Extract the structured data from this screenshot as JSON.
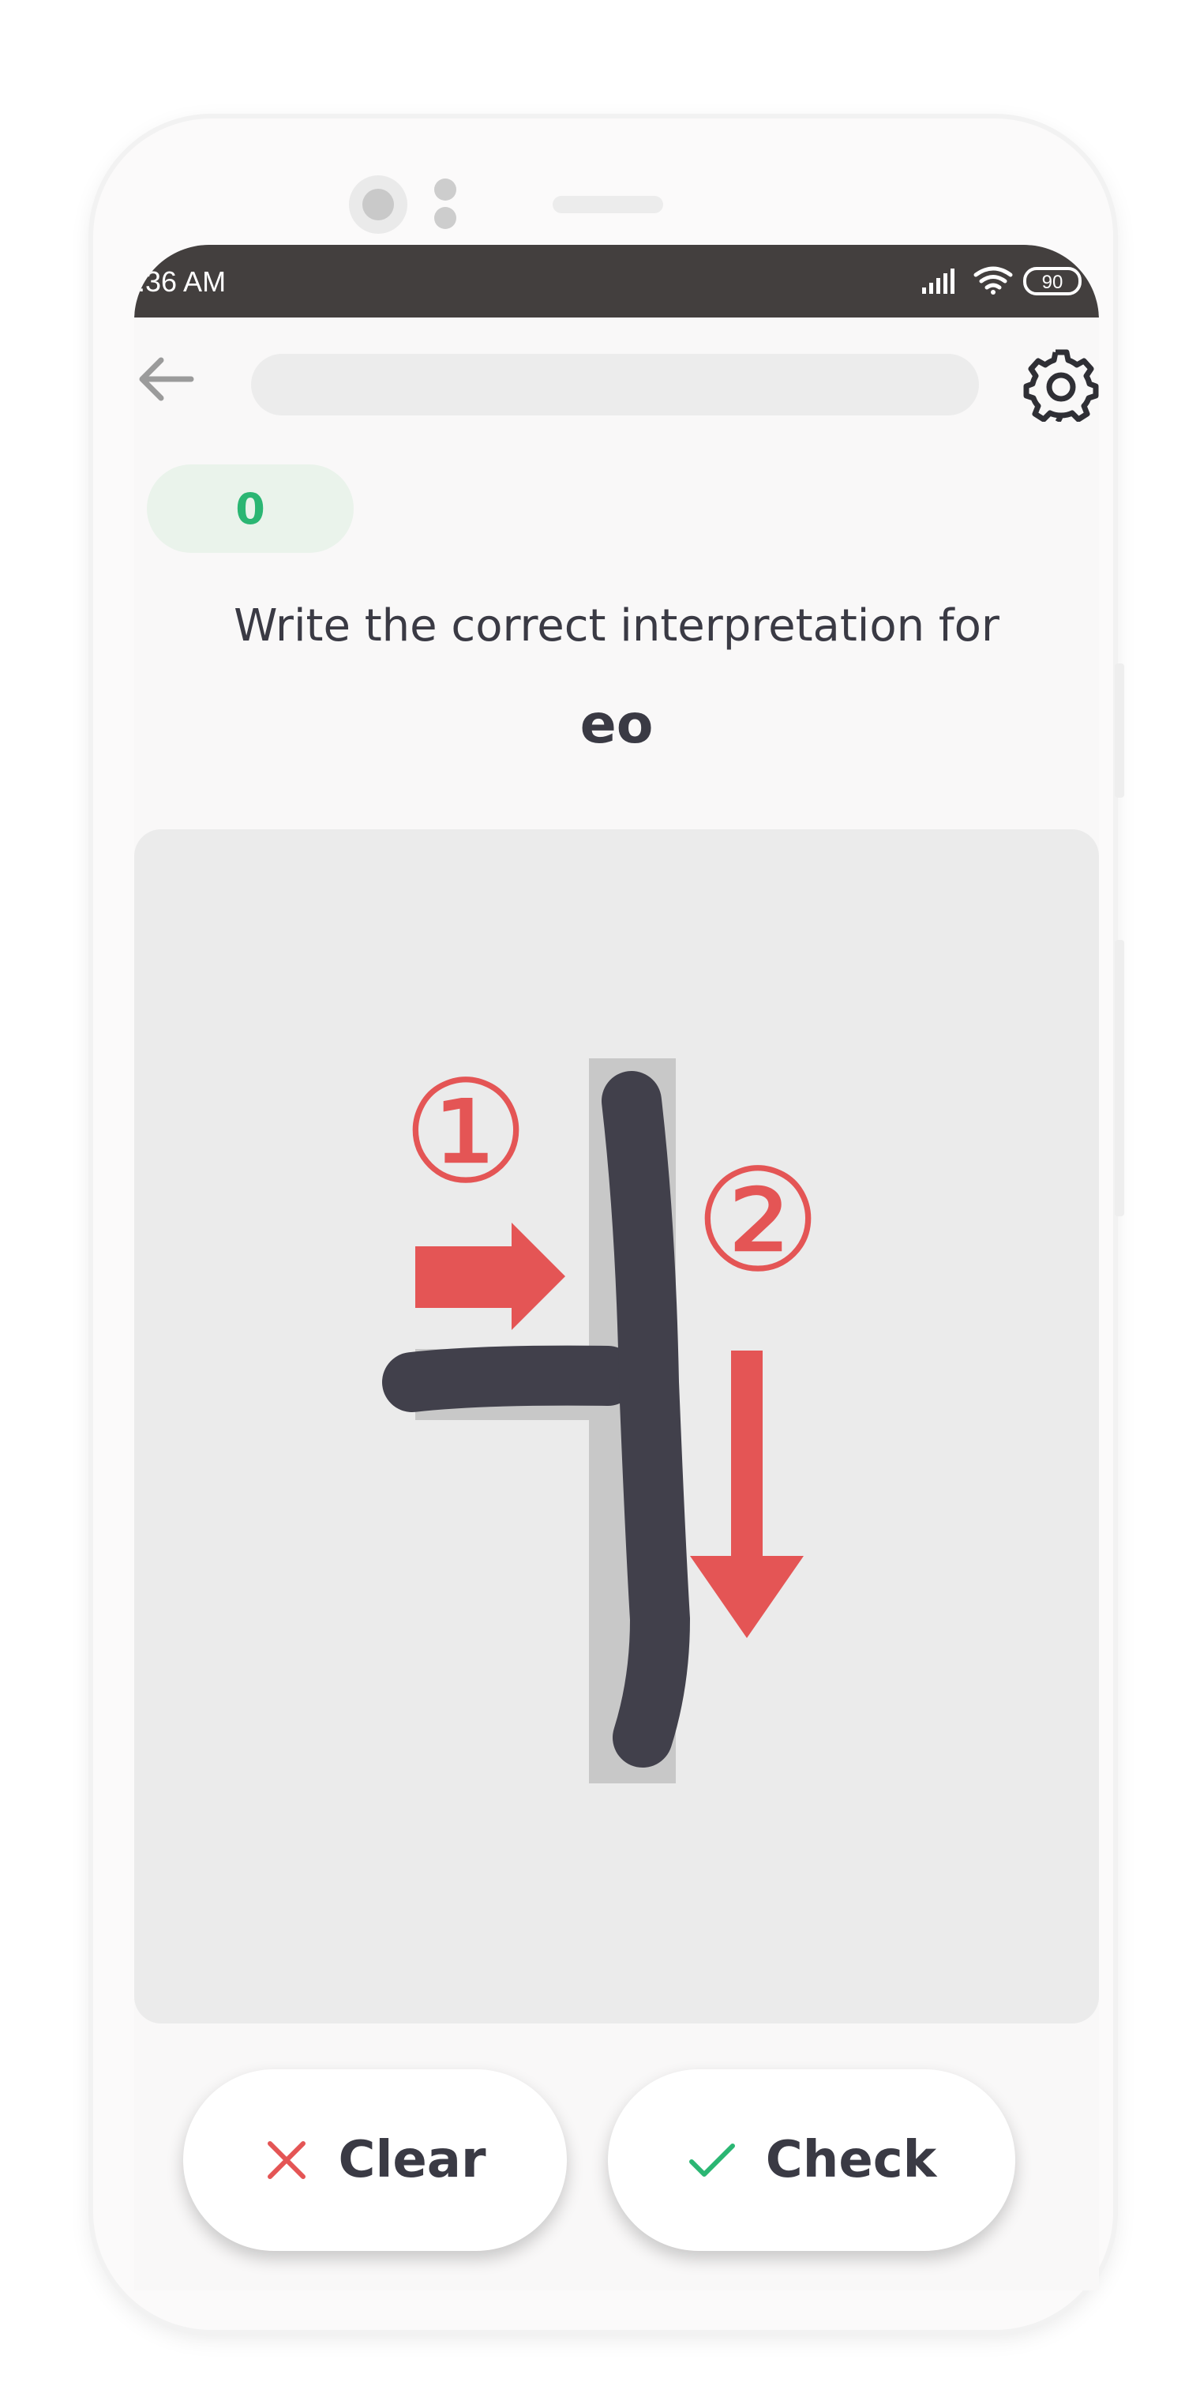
{
  "status": {
    "time": ":36 AM",
    "battery": "90"
  },
  "header": {
    "progress": 0
  },
  "score": "0",
  "prompt": "Write the correct interpretation for",
  "target": "eo",
  "stroke_guide": {
    "step1": "①",
    "step2": "②"
  },
  "buttons": {
    "clear": "Clear",
    "check": "Check"
  },
  "colors": {
    "accent_green": "#2bb673",
    "accent_red": "#e45555",
    "ink": "#3a3a44"
  }
}
